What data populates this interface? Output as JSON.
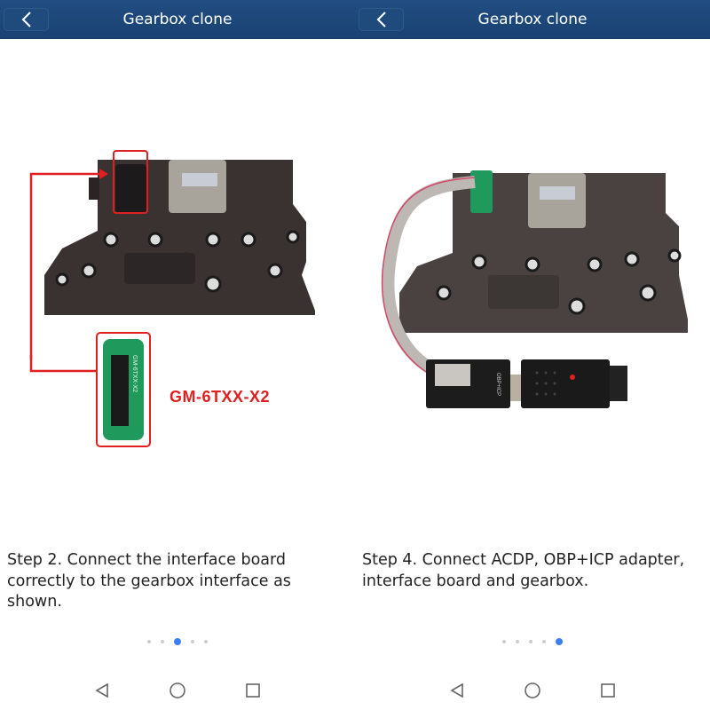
{
  "screens": [
    {
      "header": {
        "title": "Gearbox clone",
        "back_icon": "chevron-left-icon"
      },
      "image": {
        "description": "Gearbox valve body with highlighted connector and GM-6TXX-X2 interface board",
        "board_label": "GM-6TXX-X2",
        "board_silkscreen": "GM-6TXX-X2"
      },
      "caption": "Step 2. Connect the interface board correctly to the gearbox interface as shown.",
      "pager": {
        "total": 5,
        "active_index": 2
      }
    },
    {
      "header": {
        "title": "Gearbox clone",
        "back_icon": "chevron-left-icon"
      },
      "image": {
        "description": "Gearbox with interface board connected via ribbon cable to OBP+ICP adapter and ACDP",
        "adapter_label": "OBP+ICP"
      },
      "caption": "Step 4. Connect ACDP, OBP+ICP adapter, interface board and gearbox.",
      "pager": {
        "total": 5,
        "active_index": 4
      }
    }
  ],
  "navbar": {
    "back": "back-triangle-icon",
    "home": "home-circle-icon",
    "recents": "recents-square-icon"
  },
  "colors": {
    "header": "#1f4878",
    "accent": "#3a7ff0",
    "highlight": "#e02020",
    "board": "#1f9a5c"
  }
}
